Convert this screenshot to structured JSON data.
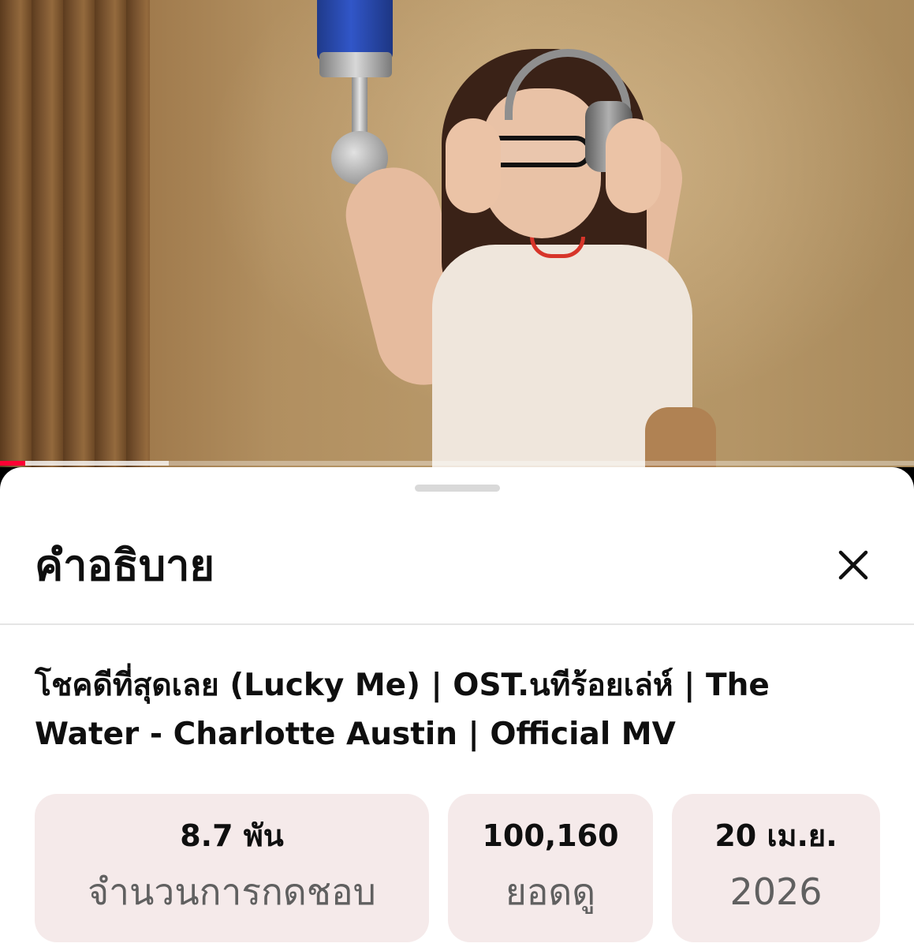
{
  "video": {
    "progress_played": 0.028,
    "progress_buffered": 0.185,
    "colors": {
      "progress": "#ff0033"
    }
  },
  "sheet": {
    "title": "คำอธิบาย",
    "close_icon": "close-icon",
    "video_title": "โชคดีที่สุดเลย (Lucky Me) | OST.นทีร้อยเล่ห์ | The Water - Charlotte Austin | Official MV",
    "stats": [
      {
        "value": "8.7 พัน",
        "label": "จำนวนการกดชอบ"
      },
      {
        "value": "100,160",
        "label": "ยอดดู"
      },
      {
        "value": "20 เม.ย.",
        "label": "2026"
      }
    ],
    "colors": {
      "stat_bg": "#f5eaea",
      "label": "#606060"
    }
  }
}
